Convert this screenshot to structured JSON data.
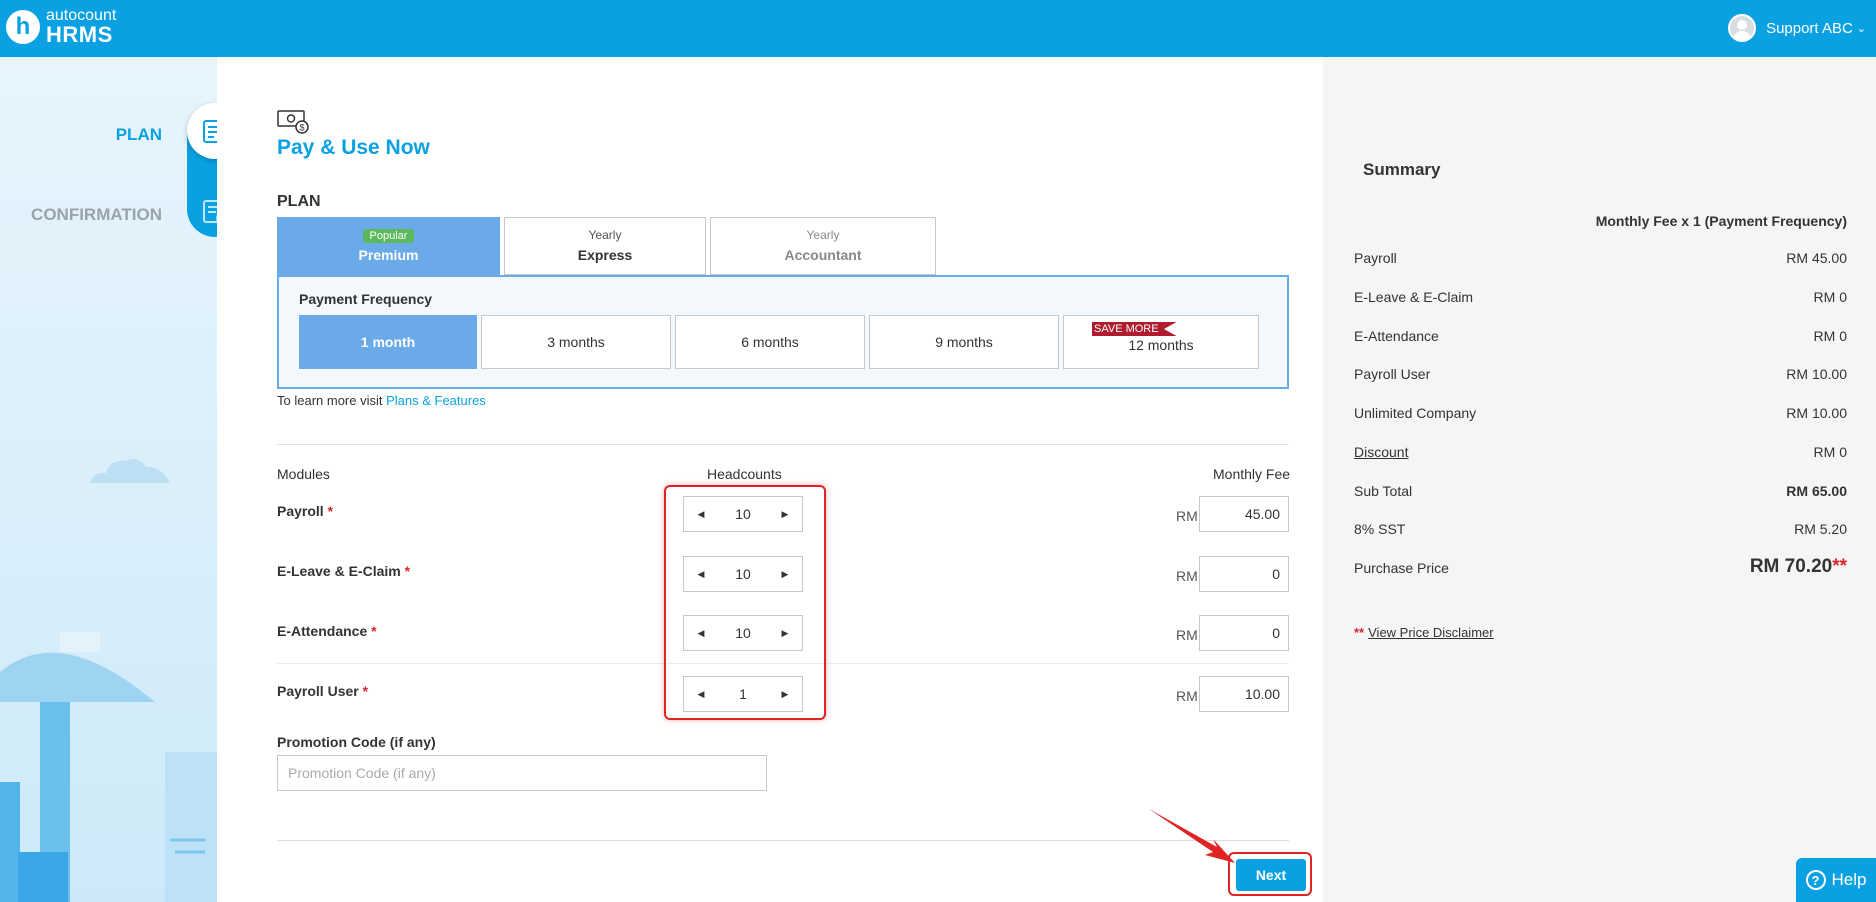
{
  "app": {
    "logo_top": "autocount",
    "logo_bottom": "HRMS",
    "logo_letter": "h"
  },
  "user": {
    "name": "Support ABC"
  },
  "steps": [
    {
      "label": "PLAN",
      "icon": "document-edit-icon",
      "active": true
    },
    {
      "label": "CONFIRMATION",
      "icon": "document-check-icon",
      "active": false
    }
  ],
  "page": {
    "title": "Pay & Use Now",
    "plan_heading": "PLAN"
  },
  "plans": [
    {
      "top": "Popular",
      "name": "Premium",
      "active": true
    },
    {
      "top": "Yearly",
      "name": "Express",
      "active": false
    },
    {
      "top": "Yearly",
      "name": "Accountant",
      "active": false
    }
  ],
  "frequency": {
    "title": "Payment Frequency",
    "options": [
      "1 month",
      "3 months",
      "6 months",
      "9 months",
      "12 months"
    ],
    "selected": "1 month",
    "save_badge": "SAVE MORE"
  },
  "learn_more": {
    "text": "To learn more visit ",
    "link": "Plans & Features"
  },
  "modules": {
    "headers": {
      "modules": "Modules",
      "headcounts": "Headcounts",
      "fee": "Monthly Fee"
    },
    "currency": "RM",
    "rows": [
      {
        "name": "Payroll",
        "required": "*",
        "count": "10",
        "fee": "45.00"
      },
      {
        "name": "E-Leave & E-Claim",
        "required": "*",
        "count": "10",
        "fee": "0"
      },
      {
        "name": "E-Attendance",
        "required": "*",
        "count": "10",
        "fee": "0"
      },
      {
        "name": "Payroll User",
        "required": "*",
        "count": "1",
        "fee": "10.00"
      }
    ]
  },
  "promo": {
    "label": "Promotion Code (if any)",
    "placeholder": "Promotion Code (if any)",
    "value": ""
  },
  "next_label": "Next",
  "summary": {
    "title": "Summary",
    "caption": "Monthly Fee x 1 (Payment Frequency)",
    "rows": [
      {
        "label": "Payroll",
        "value": "RM 45.00"
      },
      {
        "label": "E-Leave & E-Claim",
        "value": "RM 0"
      },
      {
        "label": "E-Attendance",
        "value": "RM 0"
      },
      {
        "label": "Payroll User",
        "value": "RM 10.00"
      },
      {
        "label": "Unlimited Company",
        "value": "RM 10.00"
      },
      {
        "label": "Discount",
        "value": "RM 0"
      },
      {
        "label": "Sub Total",
        "value": "RM 65.00"
      },
      {
        "label": "8% SST",
        "value": "RM 5.20"
      },
      {
        "label": "Purchase Price",
        "value": "RM 70.20"
      }
    ],
    "price_stars": "**",
    "disclaimer_stars": "**",
    "disclaimer_link": "View Price Disclaimer"
  },
  "help_label": "Help",
  "colors": {
    "brand": "#0aa1e3",
    "selected": "#6aaae8",
    "required": "#d9262c",
    "save_badge": "#b01b2e",
    "popular_badge": "#5cb85c"
  }
}
